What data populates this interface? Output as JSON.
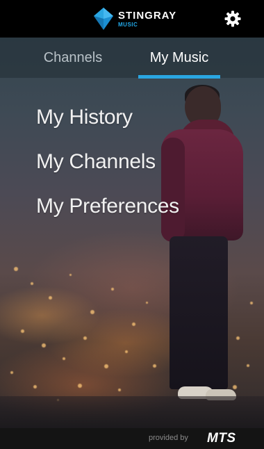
{
  "header": {
    "brand_name": "STINGRAY",
    "brand_sub": "MUSIC",
    "logo_icon": "stingray-diamond-logo",
    "settings_icon": "gear-icon"
  },
  "tabs": [
    {
      "label": "Channels",
      "active": false
    },
    {
      "label": "My Music",
      "active": true
    }
  ],
  "menu": {
    "items": [
      {
        "label": "My History"
      },
      {
        "label": "My Channels"
      },
      {
        "label": "My Preferences"
      }
    ]
  },
  "footer": {
    "provided_by": "provided by",
    "partner": "MTS"
  },
  "colors": {
    "accent": "#2aa6e2",
    "header_bg": "#000000",
    "footer_bg": "#141414"
  }
}
